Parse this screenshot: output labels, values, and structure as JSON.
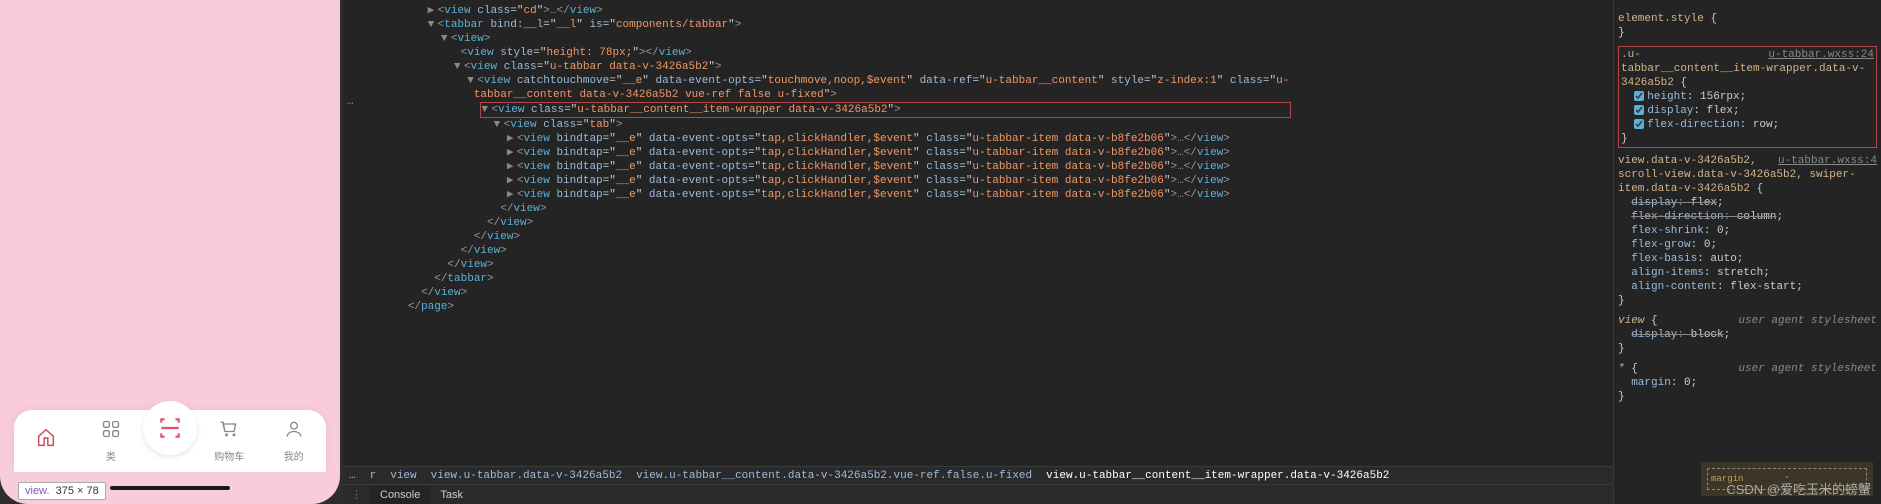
{
  "preview": {
    "tabs": [
      {
        "label": "",
        "iconName": "home-icon",
        "active": true
      },
      {
        "label": "类",
        "iconName": "grid-icon",
        "active": false
      },
      {
        "label": "",
        "iconName": "scan-icon",
        "active": false,
        "center": true
      },
      {
        "label": "购物车",
        "iconName": "cart-icon",
        "active": false
      },
      {
        "label": "我的",
        "iconName": "user-icon",
        "active": false
      }
    ],
    "tooltip_prefix": "view.",
    "tooltip_size": "375 × 78"
  },
  "dom": {
    "line0_tag": "view",
    "line0_class": "cd",
    "line1_tag": "tabbar",
    "line1_bindattr": "bind:__l",
    "line1_bindval": "__l",
    "line1_isattr": "is",
    "line1_isval": "components/tabbar",
    "line2_tag": "view",
    "line3_tag": "view",
    "line3_style": "height: 78px;",
    "line4_tag": "view",
    "line4_class": "u-tabbar data-v-3426a5b2",
    "line5_tag": "view",
    "line5_catch": "catchtouchmove",
    "line5_catchval": "__e",
    "line5_opts": "data-event-opts",
    "line5_optsval": "touchmove,noop,$event",
    "line5_ref": "data-ref",
    "line5_refval": "u-tabbar__content",
    "line5_styleattr": "style",
    "line5_styleval": "z-index:1",
    "line5_classattr": "class",
    "line5_classval_part1": "u-",
    "line5_cont": "tabbar__content data-v-3426a5b2 vue-ref false u-fixed",
    "hl_tag": "view",
    "hl_class": "u-tabbar__content__item-wrapper data-v-3426a5b2",
    "line7_tag": "view",
    "line7_class": "tab",
    "item_tag": "view",
    "item_bindattr": "bindtap",
    "item_bindval": "__e",
    "item_optsattr": "data-event-opts",
    "item_optsval": "tap,clickHandler,$event",
    "item_classattr": "class",
    "item_classval": "u-tabbar-item data-v-b8fe2b06",
    "close_view": "view",
    "close_tabbar": "tabbar",
    "close_page": "page"
  },
  "gutter_dots": "…",
  "breadcrumb": {
    "items": [
      "…",
      "r",
      "view",
      "view.u-tabbar.data-v-3426a5b2",
      "view.u-tabbar__content.data-v-3426a5b2.vue-ref.false.u-fixed",
      "view.u-tabbar__content__item-wrapper.data-v-3426a5b2"
    ]
  },
  "bottom_tabs": {
    "console": "Console",
    "task": "Task"
  },
  "styles": {
    "element_style": "element.style",
    "rule1_sel": ".u-tabbar__content__item-wrapper.data-v-3426a5b2",
    "rule1_src": "u-tabbar.wxss:24",
    "rule1_props": [
      {
        "n": "height",
        "v": "156rpx"
      },
      {
        "n": "display",
        "v": "flex"
      },
      {
        "n": "flex-direction",
        "v": "row"
      }
    ],
    "rule2_sel": "view.data-v-3426a5b2, scroll-view.data-v-3426a5b2, swiper-item.data-v-3426a5b2",
    "rule2_src": "u-tabbar.wxss:4",
    "rule2_props": [
      {
        "n": "display",
        "v": "flex",
        "strike": true
      },
      {
        "n": "flex-direction",
        "v": "column",
        "strike": true
      },
      {
        "n": "flex-shrink",
        "v": "0"
      },
      {
        "n": "flex-grow",
        "v": "0"
      },
      {
        "n": "flex-basis",
        "v": "auto"
      },
      {
        "n": "align-items",
        "v": "stretch"
      },
      {
        "n": "align-content",
        "v": "flex-start"
      }
    ],
    "rule3_sel": "view",
    "rule3_src": "user agent stylesheet",
    "rule3_props": [
      {
        "n": "display",
        "v": "block",
        "strike": true
      }
    ],
    "rule4_sel": "*",
    "rule4_src": "user agent stylesheet",
    "rule4_props": [
      {
        "n": "margin",
        "v": "0"
      }
    ],
    "box_label": "margin",
    "box_dash": "-"
  },
  "watermark": "CSDN @爱吃玉米的螃蟹"
}
